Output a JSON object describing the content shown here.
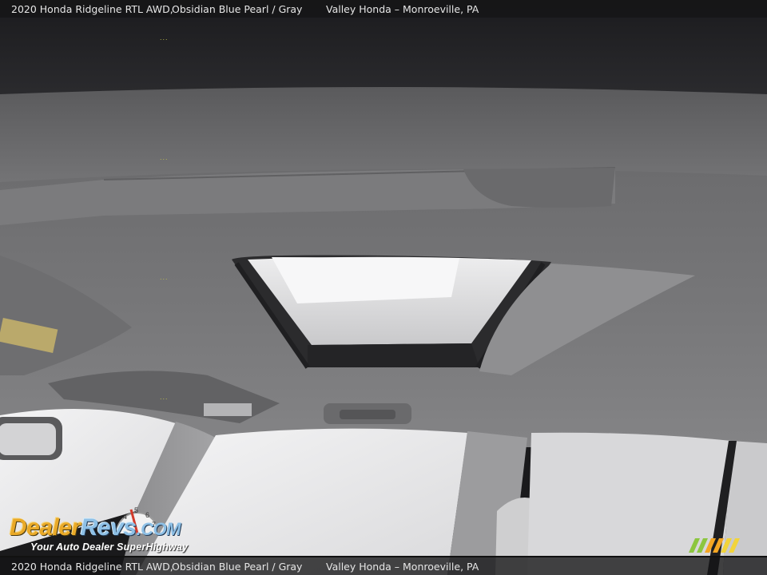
{
  "caption": {
    "vehicle": "2020 Honda Ridgeline RTL AWD,",
    "color": "Obsidian Blue Pearl / Gray",
    "dealer": "Valley Honda – Monroeville, PA"
  },
  "watermark": {
    "brand_dealer": "Dealer",
    "brand_revs": "Revs",
    "brand_com": ".COM",
    "tagline": "Your Auto Dealer SuperHighway"
  },
  "colors": {
    "headliner": "#6f6f71",
    "caption_bar": "#141416",
    "watermark_orange": "#e9a928",
    "watermark_blue": "#8ec0e6",
    "stripes_green": "#8cc63f",
    "stripes_orange": "#f5a623"
  },
  "scene": "vehicle interior headliner with open sunroof"
}
